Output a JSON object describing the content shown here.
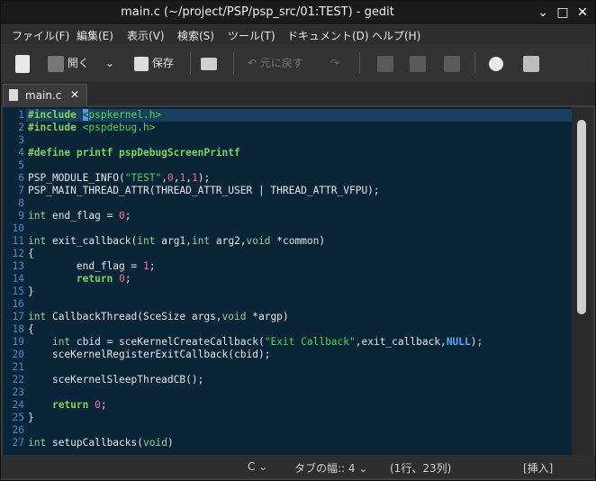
{
  "window": {
    "title": "main.c (~/project/PSP/psp_src/01:TEST) - gedit"
  },
  "menu": [
    "ファイル(F)",
    "編集(E)",
    "表示(V)",
    "検索(S)",
    "ツール(T)",
    "ドキュメント(D)",
    "ヘルプ(H)"
  ],
  "toolbar": {
    "open_label": "開く",
    "save_label": "保存",
    "undo_label": "元に戻す"
  },
  "tab": {
    "label": "main.c"
  },
  "editor": {
    "line_numbers": [
      "1",
      "2",
      "3",
      "4",
      "5",
      "6",
      "7",
      "8",
      "9",
      "10",
      "11",
      "12",
      "13",
      "14",
      "15",
      "16",
      "17",
      "18",
      "19",
      "20",
      "21",
      "22",
      "23",
      "24",
      "25",
      "26",
      "27"
    ],
    "lines": [
      [
        [
          "pp",
          "#include "
        ],
        [
          "cursor",
          "<"
        ],
        [
          "str",
          "pspkernel.h>"
        ]
      ],
      [
        [
          "pp",
          "#include "
        ],
        [
          "str",
          "<pspdebug.h>"
        ]
      ],
      [],
      [
        [
          "pp",
          "#define printf pspDebugScreenPrintf"
        ]
      ],
      [],
      [
        [
          "t",
          "PSP_MODULE_INFO("
        ],
        [
          "str",
          "\"TEST\""
        ],
        [
          "t",
          ","
        ],
        [
          "num",
          "0"
        ],
        [
          "t",
          ","
        ],
        [
          "num",
          "1"
        ],
        [
          "t",
          ","
        ],
        [
          "num",
          "1"
        ],
        [
          "t",
          ");"
        ]
      ],
      [
        [
          "t",
          "PSP_MAIN_THREAD_ATTR(THREAD_ATTR_USER | THREAD_ATTR_VFPU);"
        ]
      ],
      [],
      [
        [
          "ty",
          "int"
        ],
        [
          "t",
          " end_flag = "
        ],
        [
          "num",
          "0"
        ],
        [
          "t",
          ";"
        ]
      ],
      [],
      [
        [
          "ty",
          "int"
        ],
        [
          "t",
          " exit_callback("
        ],
        [
          "ty",
          "int"
        ],
        [
          "t",
          " arg1,"
        ],
        [
          "ty",
          "int"
        ],
        [
          "t",
          " arg2,"
        ],
        [
          "ty",
          "void"
        ],
        [
          "t",
          " *common)"
        ]
      ],
      [
        [
          "t",
          "{"
        ]
      ],
      [
        [
          "t",
          "        end_flag = "
        ],
        [
          "num",
          "1"
        ],
        [
          "t",
          ";"
        ]
      ],
      [
        [
          "t",
          "        "
        ],
        [
          "kw",
          "return"
        ],
        [
          "t",
          " "
        ],
        [
          "num",
          "0"
        ],
        [
          "t",
          ";"
        ]
      ],
      [
        [
          "t",
          "}"
        ]
      ],
      [],
      [
        [
          "ty",
          "int"
        ],
        [
          "t",
          " CallbackThread(SceSize args,"
        ],
        [
          "ty",
          "void"
        ],
        [
          "t",
          " *argp)"
        ]
      ],
      [
        [
          "t",
          "{"
        ]
      ],
      [
        [
          "t",
          "    "
        ],
        [
          "ty",
          "int"
        ],
        [
          "t",
          " cbid = sceKernelCreateCallback("
        ],
        [
          "str",
          "\"Exit Callback\""
        ],
        [
          "t",
          ",exit_callback,"
        ],
        [
          "cst",
          "NULL"
        ],
        [
          "t",
          ");"
        ]
      ],
      [
        [
          "t",
          "    sceKernelRegisterExitCallback(cbid);"
        ]
      ],
      [],
      [
        [
          "t",
          "    sceKernelSleepThreadCB();"
        ]
      ],
      [],
      [
        [
          "t",
          "    "
        ],
        [
          "kw",
          "return"
        ],
        [
          "t",
          " "
        ],
        [
          "num",
          "0"
        ],
        [
          "t",
          ";"
        ]
      ],
      [
        [
          "t",
          "}"
        ]
      ],
      [],
      [
        [
          "ty",
          "int"
        ],
        [
          "t",
          " setupCallbacks("
        ],
        [
          "ty",
          "void"
        ],
        [
          "t",
          ")"
        ]
      ]
    ]
  },
  "status": {
    "language": "C",
    "tab_width": "タブの幅:: 4",
    "position": "(1行、23列)",
    "mode": "[挿入]"
  }
}
